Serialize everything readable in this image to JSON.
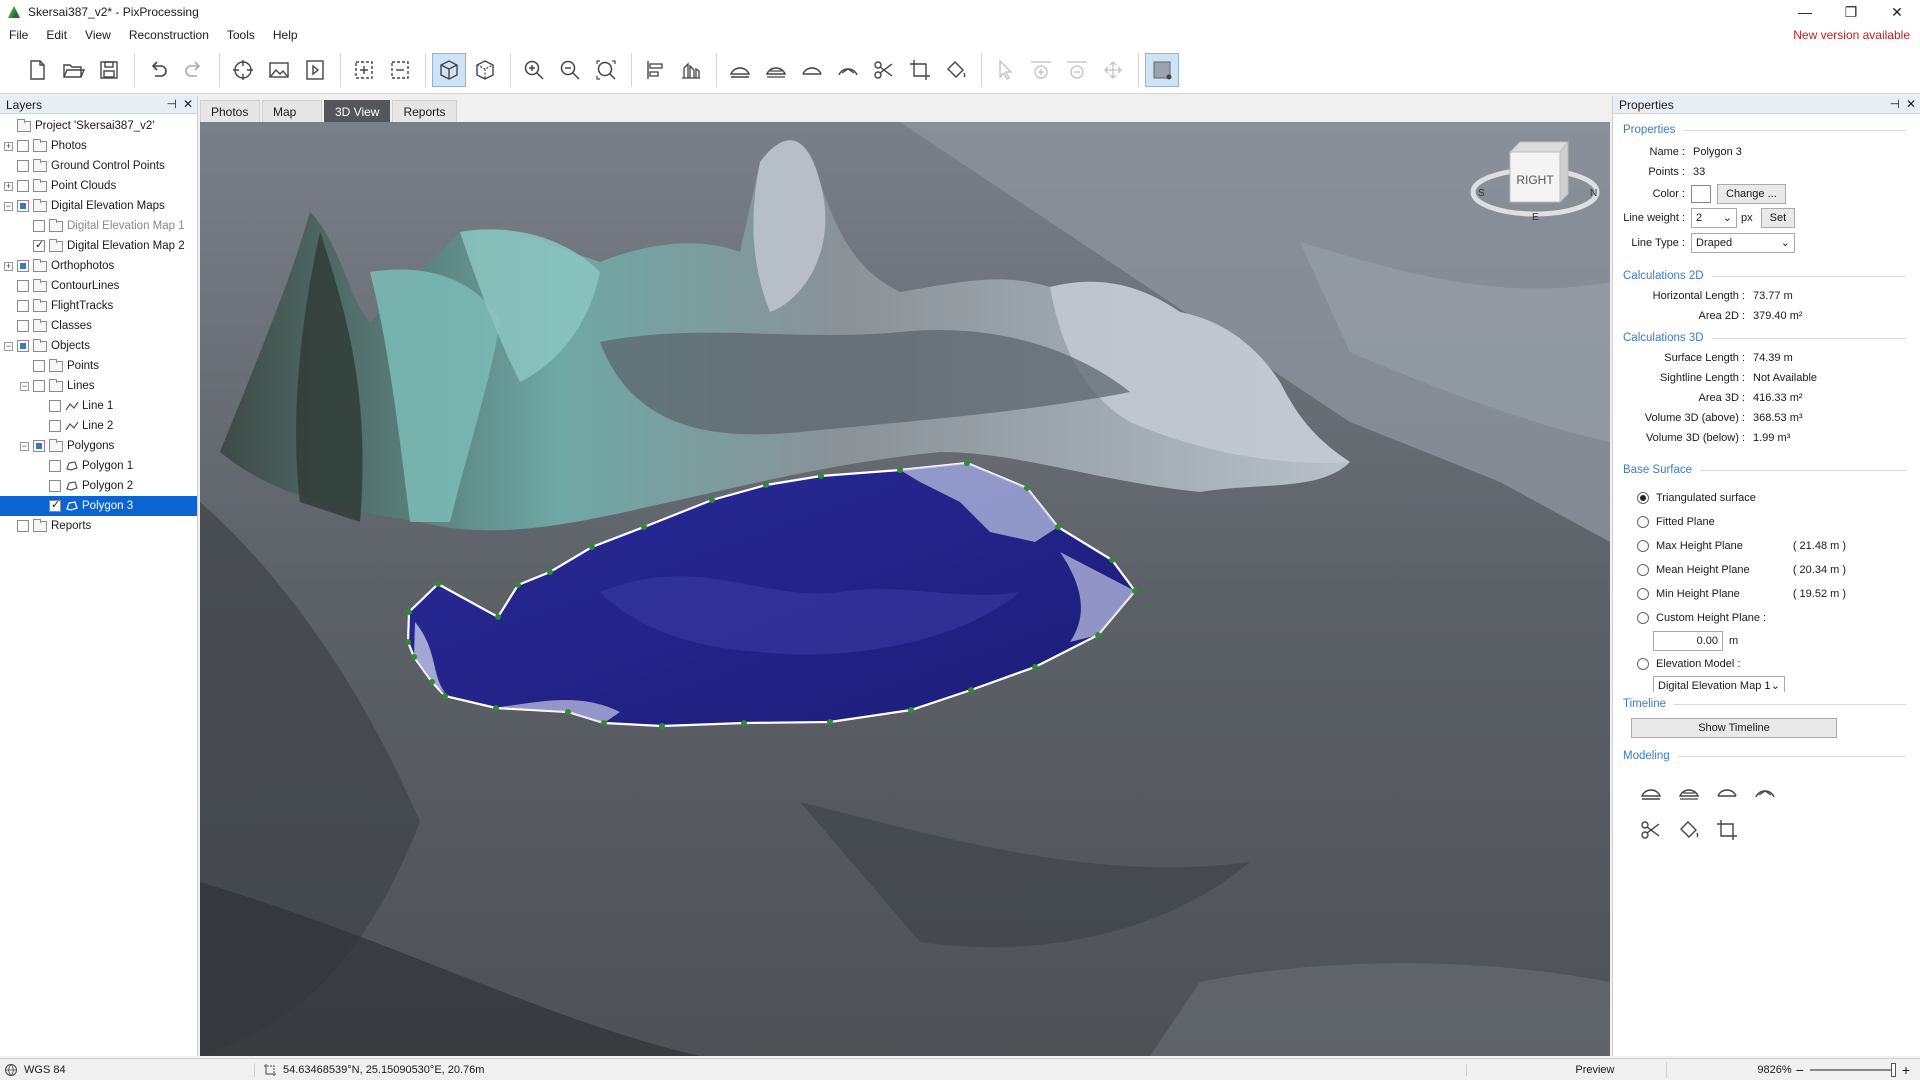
{
  "window": {
    "title": "Skersai387_v2* - PixProcessing",
    "minimize_icon": "—",
    "restore_icon": "❐",
    "close_icon": "✕"
  },
  "menu": {
    "items": [
      "File",
      "Edit",
      "View",
      "Reconstruction",
      "Tools",
      "Help"
    ],
    "new_version": "New version available"
  },
  "layers": {
    "title": "Layers",
    "pin_icon": "⊣",
    "close_icon": "✕",
    "tree": [
      {
        "label": "Project 'Skersai387_v2'",
        "level": 0,
        "expander": "none",
        "check": "none",
        "folder": true,
        "type": "project"
      },
      {
        "label": "Photos",
        "level": 0,
        "expander": "+",
        "check": "unchecked",
        "folder": true
      },
      {
        "label": "Ground Control Points",
        "level": 0,
        "expander": "none",
        "check": "unchecked",
        "folder": true
      },
      {
        "label": "Point Clouds",
        "level": 0,
        "expander": "+",
        "check": "unchecked",
        "folder": true
      },
      {
        "label": "Digital Elevation Maps",
        "level": 0,
        "expander": "−",
        "check": "partial",
        "folder": true
      },
      {
        "label": "Digital Elevation Map 1",
        "level": 1,
        "expander": "none",
        "check": "unchecked",
        "folder": true,
        "dim": true
      },
      {
        "label": "Digital Elevation Map 2",
        "level": 1,
        "expander": "none",
        "check": "checked",
        "folder": true
      },
      {
        "label": "Orthophotos",
        "level": 0,
        "expander": "+",
        "check": "partial",
        "folder": true
      },
      {
        "label": "ContourLines",
        "level": 0,
        "expander": "none",
        "check": "unchecked",
        "folder": true
      },
      {
        "label": "FlightTracks",
        "level": 0,
        "expander": "none",
        "check": "unchecked",
        "folder": true
      },
      {
        "label": "Classes",
        "level": 0,
        "expander": "none",
        "check": "unchecked",
        "folder": true
      },
      {
        "label": "Objects",
        "level": 0,
        "expander": "−",
        "check": "partial",
        "folder": true
      },
      {
        "label": "Points",
        "level": 1,
        "expander": "none",
        "check": "unchecked",
        "folder": true
      },
      {
        "label": "Lines",
        "level": 1,
        "expander": "−",
        "check": "unchecked",
        "folder": true
      },
      {
        "label": "Line 1",
        "level": 2,
        "expander": "none",
        "check": "unchecked",
        "folder": false,
        "icon": "line-icon"
      },
      {
        "label": "Line 2",
        "level": 2,
        "expander": "none",
        "check": "unchecked",
        "folder": false,
        "icon": "line-icon"
      },
      {
        "label": "Polygons",
        "level": 1,
        "expander": "−",
        "check": "partial",
        "folder": true
      },
      {
        "label": "Polygon 1",
        "level": 2,
        "expander": "none",
        "check": "unchecked",
        "folder": false,
        "icon": "polygon-icon"
      },
      {
        "label": "Polygon 2",
        "level": 2,
        "expander": "none",
        "check": "unchecked",
        "folder": false,
        "icon": "polygon-icon"
      },
      {
        "label": "Polygon 3",
        "level": 2,
        "expander": "none",
        "check": "checked",
        "folder": false,
        "icon": "polygon-icon",
        "selected": true
      },
      {
        "label": "Reports",
        "level": 0,
        "expander": "none",
        "check": "unchecked",
        "folder": true
      }
    ]
  },
  "tabs": [
    {
      "label": "Photos",
      "active": false
    },
    {
      "label": "Map",
      "active": false
    },
    {
      "label": "3D View",
      "active": true
    },
    {
      "label": "Reports",
      "active": false
    }
  ],
  "view": {
    "nav_cube_label": "RIGHT",
    "compass": {
      "w": "S",
      "e": "N",
      "s": "E"
    }
  },
  "properties": {
    "title": "Properties",
    "pin_icon": "⊣",
    "close_icon": "✕",
    "section_properties": "Properties",
    "name_label": "Name :",
    "name_value": "Polygon 3",
    "points_label": "Points :",
    "points_value": "33",
    "color_label": "Color :",
    "change_button": "Change ...",
    "line_weight_label": "Line weight :",
    "line_weight_value": "2",
    "line_weight_unit": "px",
    "set_button": "Set",
    "line_type_label": "Line Type :",
    "line_type_value": "Draped",
    "section_calc2d": "Calculations 2D",
    "calc2d": [
      {
        "label": "Horizontal Length :",
        "value": "73.77 m"
      },
      {
        "label": "Area 2D :",
        "value": "379.40 m²"
      }
    ],
    "section_calc3d": "Calculations 3D",
    "calc3d": [
      {
        "label": "Surface Length :",
        "value": "74.39 m"
      },
      {
        "label": "Sightline Length :",
        "value": "Not Available"
      },
      {
        "label": "Area 3D :",
        "value": "416.33 m²"
      },
      {
        "label": "Volume 3D (above) :",
        "value": "368.53 m³"
      },
      {
        "label": "Volume 3D (below) :",
        "value": "1.99 m³"
      }
    ],
    "section_base": "Base Surface",
    "base_options": [
      {
        "label": "Triangulated surface",
        "selected": true,
        "extra": ""
      },
      {
        "label": "Fitted Plane",
        "selected": false,
        "extra": ""
      },
      {
        "label": "Max Height Plane",
        "selected": false,
        "extra": "( 21.48 m )"
      },
      {
        "label": "Mean Height Plane",
        "selected": false,
        "extra": "( 20.34 m )"
      },
      {
        "label": "Min Height Plane",
        "selected": false,
        "extra": "( 19.52 m )"
      },
      {
        "label": "Custom Height Plane :",
        "selected": false,
        "extra": ""
      }
    ],
    "custom_height_value": "0.00",
    "custom_height_unit": "m",
    "elevation_model_label": "Elevation Model :",
    "elevation_model_value": "Digital Elevation Map 1",
    "section_timeline": "Timeline",
    "show_timeline_button": "Show Timeline",
    "section_modeling": "Modeling"
  },
  "status": {
    "crs": "WGS 84",
    "coords": "54.63468539°N, 25.15090530°E, 20.76m",
    "preview": "Preview",
    "zoom": "9826%",
    "zoom_out": "−",
    "zoom_in": "+"
  },
  "colors": {
    "accent": "#0a64d2",
    "section_title": "#3b7bc7",
    "polygon_fill": "#20208a",
    "vertex": "#2e8b2e",
    "new_version": "#c0201f"
  }
}
